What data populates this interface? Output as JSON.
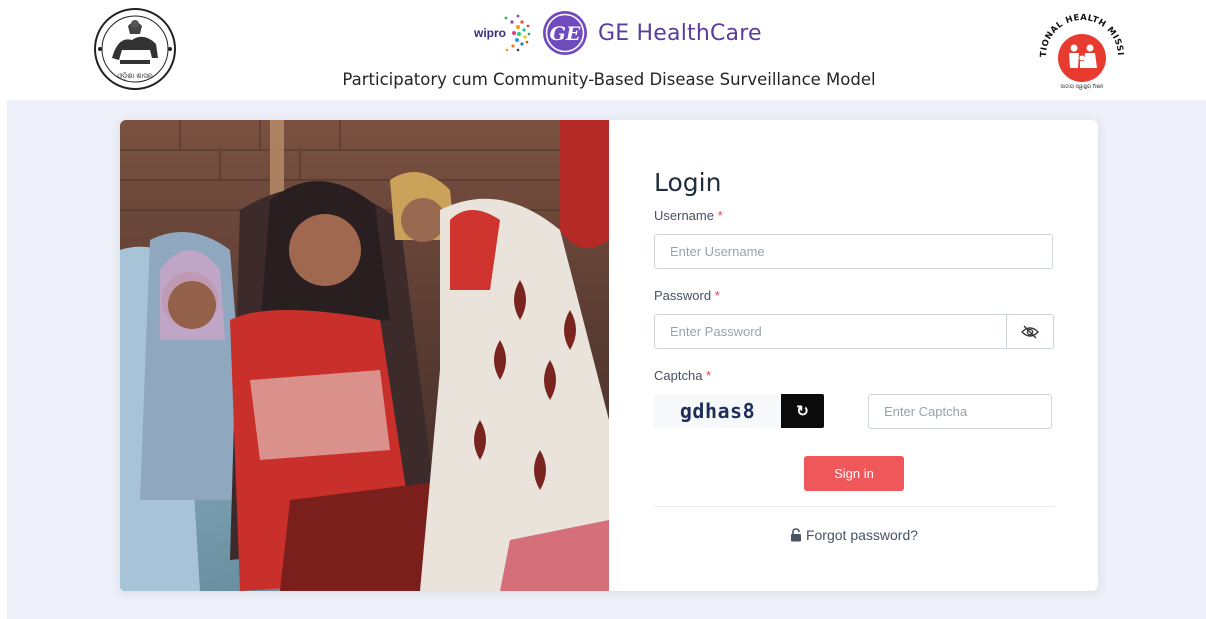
{
  "header": {
    "wipro_text": "wipro",
    "ge_monogram": "GE",
    "ge_name": "GE HealthCare",
    "subtitle": "Participatory cum Community-Based Disease Surveillance Model",
    "emblem_text": "ଓଡ଼ିଶା ଶାସନ",
    "nhm_text": "NATIONAL HEALTH MISSION",
    "nhm_subtext": "ଜାତୀୟ ସ୍ୱାସ୍ଥ୍ୟ ମିଶନ"
  },
  "login": {
    "title": "Login",
    "required_mark": "*",
    "username_label": "Username",
    "username_placeholder": "Enter Username",
    "password_label": "Password",
    "password_placeholder": "Enter Password",
    "captcha_label": "Captcha",
    "captcha_value": "gdhas8",
    "refresh_symbol": "↻",
    "captcha_placeholder": "Enter Captcha",
    "signin_label": "Sign in",
    "forgot_label": "Forgot password?"
  },
  "icons": {
    "eye": "eye-slash-icon",
    "refresh": "refresh-icon",
    "lock": "unlock-icon"
  },
  "colors": {
    "accent_button": "#f0575b",
    "ge_purple": "#5c3c9e",
    "stage_background": "#edf0f8",
    "required": "#e5434f"
  }
}
